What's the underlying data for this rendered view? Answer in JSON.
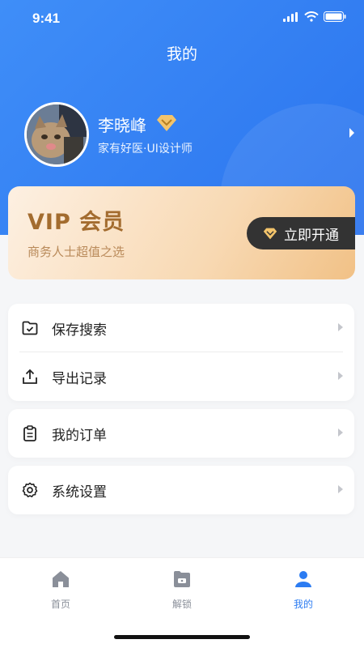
{
  "status_bar": {
    "time": "9:41"
  },
  "header": {
    "title": "我的"
  },
  "profile": {
    "name": "李晓峰",
    "subtitle": "家有好医·UI设计师"
  },
  "vip": {
    "title": "VIP 会员",
    "subtitle": "商务人士超值之选",
    "button_label": "立即开通"
  },
  "menu": {
    "group1": [
      {
        "label": "保存搜索",
        "icon": "folder-check-icon"
      },
      {
        "label": "导出记录",
        "icon": "upload-icon"
      }
    ],
    "group2": [
      {
        "label": "我的订单",
        "icon": "clipboard-icon"
      }
    ],
    "group3": [
      {
        "label": "系统设置",
        "icon": "gear-icon"
      }
    ]
  },
  "tabbar": {
    "items": [
      {
        "label": "首页",
        "icon": "home-icon"
      },
      {
        "label": "解锁",
        "icon": "unlock-folder-icon"
      },
      {
        "label": "我的",
        "icon": "user-icon"
      }
    ],
    "active_index": 2
  },
  "colors": {
    "primary": "#2c7cf2",
    "vip_gold": "#a36c2f",
    "vip_button": "#333333"
  }
}
